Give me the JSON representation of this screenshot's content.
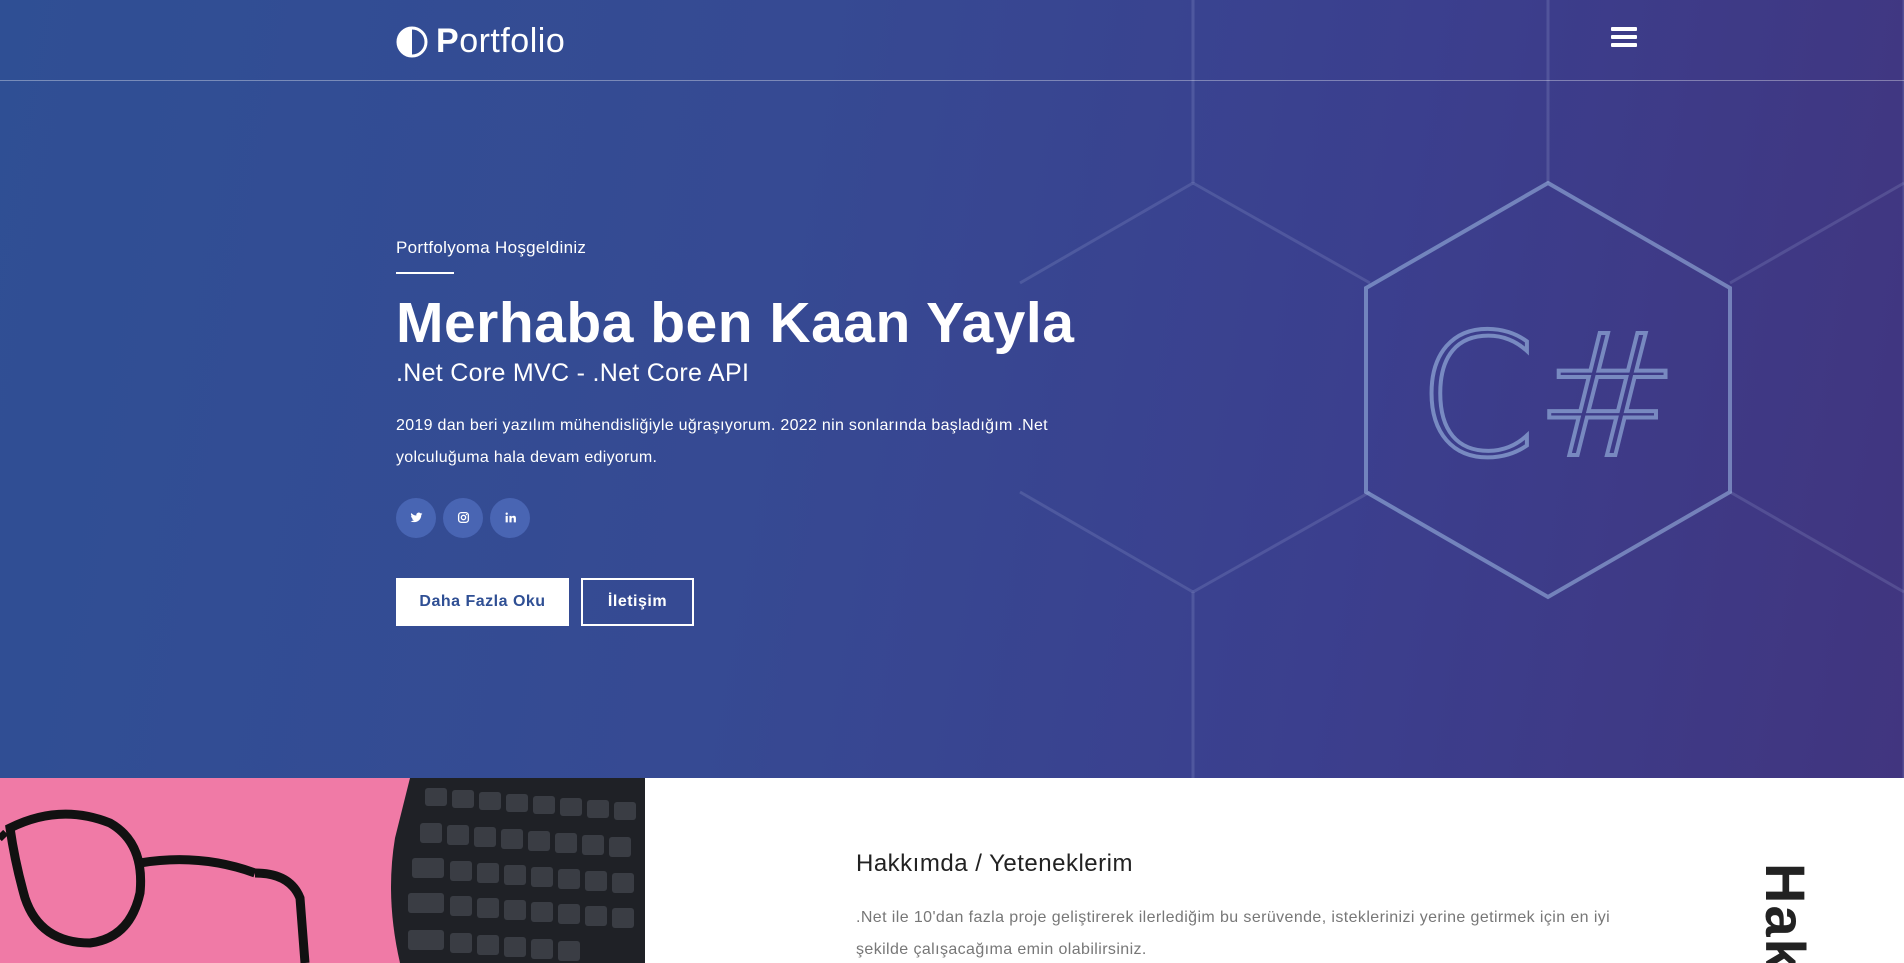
{
  "brand": {
    "logo_bold": "P",
    "logo_rest": "ortfolio"
  },
  "nav": {
    "menu_icon": "hamburger-menu-icon"
  },
  "hero": {
    "welcome": "Portfolyoma Hoşgeldiniz",
    "name": "Merhaba ben Kaan Yayla",
    "role": ".Net Core MVC - .Net Core API",
    "bio": "2019 dan beri yazılım mühendisliğiyle uğraşıyorum. 2022 nin sonlarında başladığım .Net yolculuğuma hala devam ediyorum.",
    "socials": [
      "twitter-icon",
      "instagram-icon",
      "linkedin-icon"
    ],
    "primary_button": "Daha Fazla Oku",
    "secondary_button": "İletişim",
    "background_logo_text": "C#"
  },
  "about": {
    "title": "Hakkımda / Yeteneklerim",
    "text": ".Net ile 10'dan fazla proje geliştirerek ilerlediğim bu serüvende, isteklerinizi yerine getirmek için en iyi şekilde çalışacağıma emin olabilirsiniz.",
    "vertical_label": "Hak"
  },
  "colors": {
    "hero_gradient_start": "#2f4f94",
    "hero_gradient_end": "#41357f",
    "about_image_bg": "#f07aa6"
  }
}
